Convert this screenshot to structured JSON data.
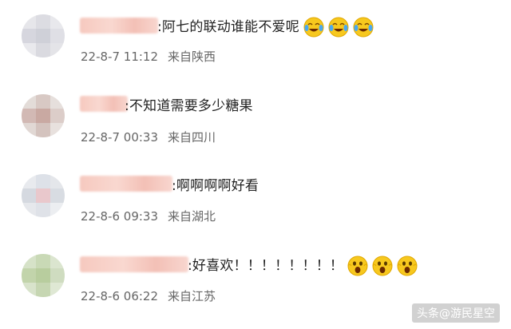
{
  "comments": [
    {
      "text": ":阿七的联动谁能不爱呢",
      "date": "22-8-7",
      "time": "11:12",
      "location": "来自陕西",
      "emoji_icon": "crying-laughing-emoji-icon",
      "emoji_count": 3
    },
    {
      "text": ":不知道需要多少糖果",
      "date": "22-8-7",
      "time": "00:33",
      "location": "来自四川",
      "emoji_icon": "",
      "emoji_count": 0
    },
    {
      "text": ":啊啊啊啊好看",
      "date": "22-8-6",
      "time": "09:33",
      "location": "来自湖北",
      "emoji_icon": "",
      "emoji_count": 0
    },
    {
      "text": ":好喜欢！！！！！！！！",
      "date": "22-8-6",
      "time": "06:22",
      "location": "来自江苏",
      "emoji_icon": "shocked-emoji-icon",
      "emoji_count": 3
    }
  ],
  "watermark": "头条@游民星空",
  "colors": {
    "text": "#222222",
    "meta": "#666666",
    "emoji_yellow": "#f7c81e",
    "name_blur": "#f6c9bf"
  }
}
